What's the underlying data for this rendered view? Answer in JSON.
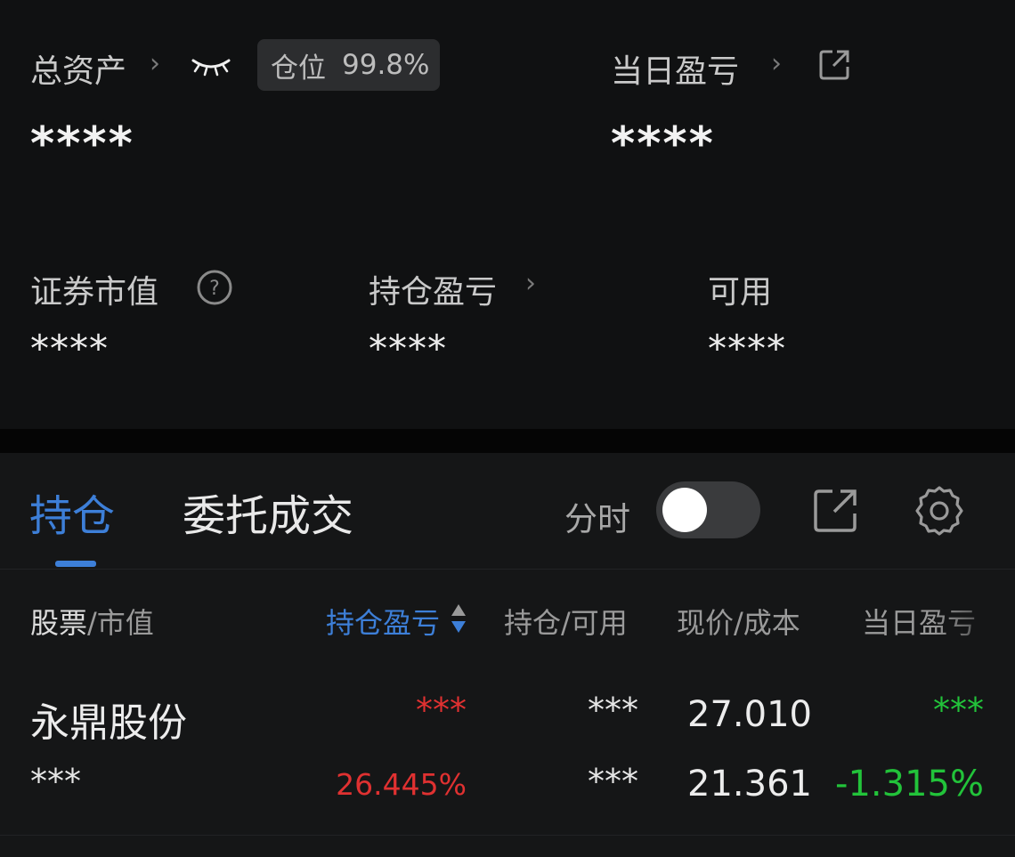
{
  "summary": {
    "total_assets_label": "总资产",
    "total_assets_value": "****",
    "position_badge": {
      "label": "仓位",
      "value": "99.8%"
    },
    "daily_pnl_label": "当日盈亏",
    "daily_pnl_value": "****",
    "market_value_label": "证券市值",
    "market_value_value": "****",
    "holding_pnl_label": "持仓盈亏",
    "holding_pnl_value": "****",
    "available_label": "可用",
    "available_value": "****"
  },
  "tabs": [
    {
      "label": "持仓",
      "active": true
    },
    {
      "label": "委托成交",
      "active": false
    }
  ],
  "toolbar": {
    "timeshare_label": "分时",
    "timeshare_on": false
  },
  "table": {
    "headers": {
      "stock": "股票",
      "market_value": "/市值",
      "holding_pnl": "持仓盈亏",
      "holding_available": "持仓/可用",
      "price_cost": "现价/成本",
      "daily_pnl": "当日盈亏"
    },
    "rows": [
      {
        "name": "永鼎股份",
        "market_value": "***",
        "holding_pnl": "***",
        "holding_pnl_pct": "26.445%",
        "holding": "***",
        "available": "***",
        "price": "27.010",
        "cost": "21.361",
        "daily_pnl": "***",
        "daily_pnl_pct": "-1.315%"
      }
    ]
  },
  "colors": {
    "accent": "#3d7fd8",
    "gain": "#e03131",
    "loss": "#22c33a",
    "background": "#101112"
  }
}
